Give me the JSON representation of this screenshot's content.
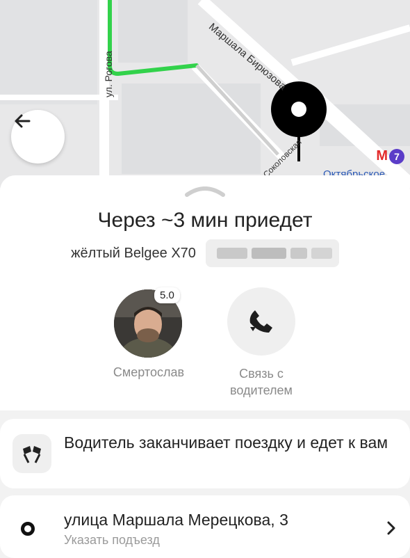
{
  "map": {
    "street_top": "Маршала Бирюзова",
    "street_left": "ул. Рогова",
    "street_bottom": "Соколовская",
    "metro_line": "7",
    "metro_letter": "М",
    "station_partial": "Октябрьское"
  },
  "icons": {
    "back": "arrow-left-icon",
    "call": "phone-icon",
    "status": "checkered-flags-icon",
    "chevron": "chevron-right-icon"
  },
  "trip": {
    "eta": "Через ~3 мин приедет",
    "car": "жёлтый Belgee X70"
  },
  "driver": {
    "name": "Смертослав",
    "rating": "5.0"
  },
  "call": {
    "label": "Связь с водителем"
  },
  "status": {
    "text": "Водитель заканчивает поездку и едет к вам"
  },
  "address": {
    "main": "улица Маршала Мерецкова, 3",
    "hint": "Указать подъезд"
  },
  "colors": {
    "route": "#32d24b",
    "accent_metro": "#e32b2b",
    "metro_line": "#5b3dc8"
  }
}
